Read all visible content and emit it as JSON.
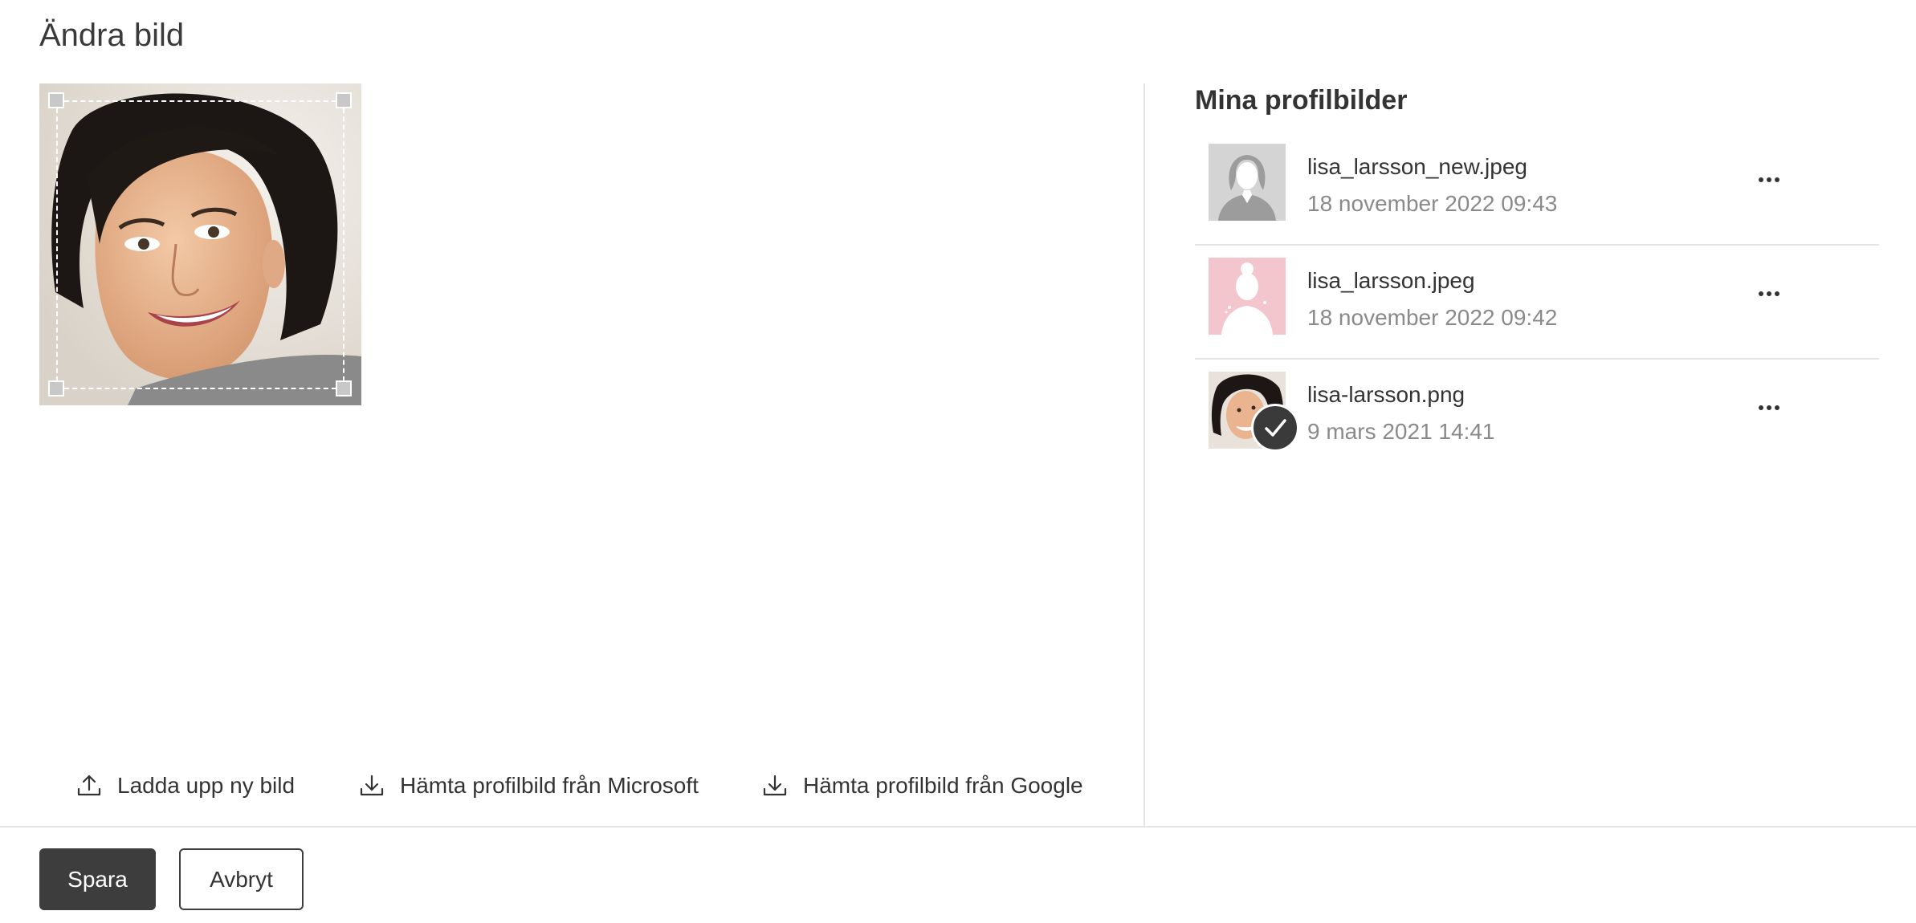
{
  "dialog": {
    "title": "Ändra bild"
  },
  "editor": {
    "actions": [
      {
        "label": "Ladda upp ny bild",
        "icon": "upload-icon"
      },
      {
        "label": "Hämta profilbild från Microsoft",
        "icon": "download-icon"
      },
      {
        "label": "Hämta profilbild från Google",
        "icon": "download-icon"
      }
    ]
  },
  "profile_images": {
    "title": "Mina profilbilder",
    "items": [
      {
        "filename": "lisa_larsson_new.jpeg",
        "date": "18 november 2022 09:43",
        "thumbnail": "gray-silhouette",
        "selected": false
      },
      {
        "filename": "lisa_larsson.jpeg",
        "date": "18 november 2022 09:42",
        "thumbnail": "pink-silhouette",
        "selected": false
      },
      {
        "filename": "lisa-larsson.png",
        "date": "9 mars 2021 14:41",
        "thumbnail": "portrait-photo",
        "selected": true
      }
    ]
  },
  "footer": {
    "save_label": "Spara",
    "cancel_label": "Avbryt"
  },
  "colors": {
    "primary_button": "#3d3d3d",
    "muted_text": "#8a8a8a",
    "divider": "#e4e4e4",
    "pink_thumb": "#f2c6cc",
    "gray_thumb": "#d4d4d4"
  }
}
